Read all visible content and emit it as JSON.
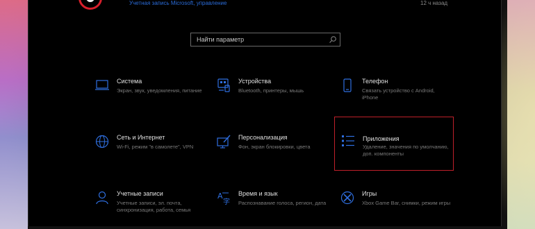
{
  "header": {
    "link_text": "Учетная запись Microsoft, управление",
    "right_text": "12 ч назад"
  },
  "search": {
    "placeholder": "Найти параметр"
  },
  "tiles": [
    {
      "title": "Система",
      "desc": "Экран, звук, уведомления, питание",
      "icon": "laptop-icon"
    },
    {
      "title": "Устройства",
      "desc": "Bluetooth, принтеры, мышь",
      "icon": "devices-icon"
    },
    {
      "title": "Телефон",
      "desc": "Связать устройство с Android, iPhone",
      "icon": "phone-icon"
    },
    {
      "title": "Сеть и Интернет",
      "desc": "Wi-Fi, режим \"в самолете\", VPN",
      "icon": "globe-icon"
    },
    {
      "title": "Персонализация",
      "desc": "Фон, экран блокировки, цвета",
      "icon": "personalization-icon"
    },
    {
      "title": "Приложения",
      "desc": "Удаление, значения по умолчанию, доп. компоненты",
      "icon": "apps-icon"
    },
    {
      "title": "Учетные записи",
      "desc": "Учетные записи, эл. почта, синхронизация, работа, семья",
      "icon": "person-icon"
    },
    {
      "title": "Время и язык",
      "desc": "Распознавание голоса, регион, дата",
      "icon": "time-language-icon"
    },
    {
      "title": "Игры",
      "desc": "Xbox Game Bar, снимки, режим игры",
      "icon": "xbox-icon"
    }
  ],
  "colors": {
    "accent": "#2f6fe0",
    "selection_border": "#c0202a"
  }
}
